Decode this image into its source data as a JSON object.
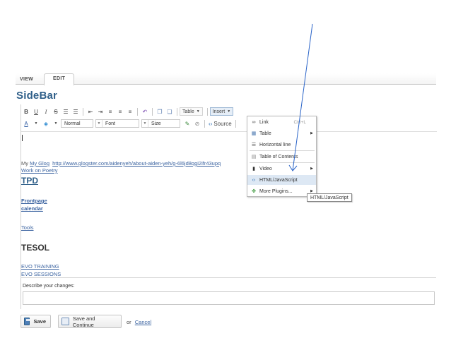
{
  "tabs": {
    "view": "VIEW",
    "edit": "EDIT"
  },
  "page": {
    "title": "SideBar"
  },
  "toolbar": {
    "row1": {
      "bold": "B",
      "underline": "U",
      "italic": "I",
      "strike": "S",
      "table_label": "Table",
      "insert_label": "Insert"
    },
    "row2": {
      "format_value": "Normal",
      "font_value": "Font",
      "size_value": "Size",
      "source_label": "Source"
    }
  },
  "content": {
    "line_myglog": "My Glog",
    "line_url": "http://www.glogster.com/aidenyeh/about-aiden-yeh/g-6l6jd8qgi2ifr43upq",
    "line_poetry": "Work on Poetry",
    "heading_tpd": "TPD",
    "link_frontpage": "Frontpage",
    "link_calendar": "calendar",
    "link_tools": "Tools",
    "heading_tesol": "TESOL",
    "link_evo_training": "EVO TRAINING",
    "link_evo_sessions": "EVO SESSIONS"
  },
  "insert_menu": {
    "items": [
      {
        "label": "Link",
        "shortcut": "Ctrl+L",
        "icon": "link-icon"
      },
      {
        "label": "Table",
        "icon": "table-icon",
        "submenu": true
      },
      {
        "label": "Horizontal line",
        "icon": "horizontal-line-icon"
      },
      {
        "label": "Table of Contents",
        "icon": "toc-icon"
      },
      {
        "label": "Video",
        "icon": "video-icon",
        "submenu": true
      },
      {
        "label": "HTML/JavaScript",
        "icon": "code-icon",
        "highlighted": true
      },
      {
        "label": "More Plugins...",
        "icon": "plugin-icon",
        "submenu": true
      }
    ]
  },
  "tooltip": {
    "text": "HTML/JavaScript"
  },
  "changes": {
    "label": "Describe your changes:",
    "value": ""
  },
  "actions": {
    "save": "Save",
    "save_continue": "Save and Continue",
    "or": "or",
    "cancel": "Cancel"
  },
  "colors": {
    "title": "#2f5f89",
    "link": "#3b63a0",
    "highlight": "#dde8f4",
    "annotation_line": "#2a64c8"
  }
}
